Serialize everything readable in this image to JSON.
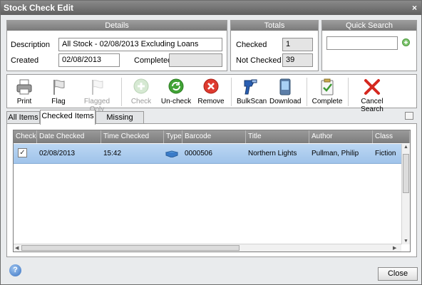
{
  "window": {
    "title": "Stock Check Edit",
    "close_glyph": "×"
  },
  "details": {
    "header": "Details",
    "description_label": "Description",
    "description_value": "All Stock - 02/08/2013 Excluding Loans",
    "created_label": "Created",
    "created_value": "02/08/2013",
    "completed_label": "Completed",
    "completed_value": ""
  },
  "totals": {
    "header": "Totals",
    "checked_label": "Checked",
    "checked_value": "1",
    "not_checked_label": "Not Checked",
    "not_checked_value": "39"
  },
  "quick_search": {
    "header": "Quick Search",
    "value": ""
  },
  "toolbar": {
    "print": "Print",
    "flag": "Flag",
    "flagged_only": "Flagged Only",
    "check": "Check",
    "uncheck": "Un-check",
    "remove": "Remove",
    "bulkscan": "BulkScan",
    "download": "Download",
    "complete": "Complete",
    "cancel_search": "Cancel Search"
  },
  "tabs": [
    "All Items",
    "Checked Items",
    "Missing Items"
  ],
  "active_tab": "Checked Items",
  "grid": {
    "columns": [
      "Checked",
      "Date Checked",
      "Time Checked",
      "Type",
      "Barcode",
      "Title",
      "Author",
      "Class"
    ],
    "rows": [
      {
        "checked": true,
        "check_glyph": "✓",
        "date": "02/08/2013",
        "time": "15:42",
        "type_icon": "book-icon",
        "barcode": "0000506",
        "title": "Northern Lights",
        "author": "Pullman, Philip",
        "class": "Fiction"
      }
    ]
  },
  "footer": {
    "help_glyph": "?",
    "close_label": "Close"
  },
  "colors": {
    "title_bar": "#6e6e6e",
    "selected_row": "#aecdef",
    "accent_green": "#4caf50",
    "accent_red": "#d9302a"
  }
}
